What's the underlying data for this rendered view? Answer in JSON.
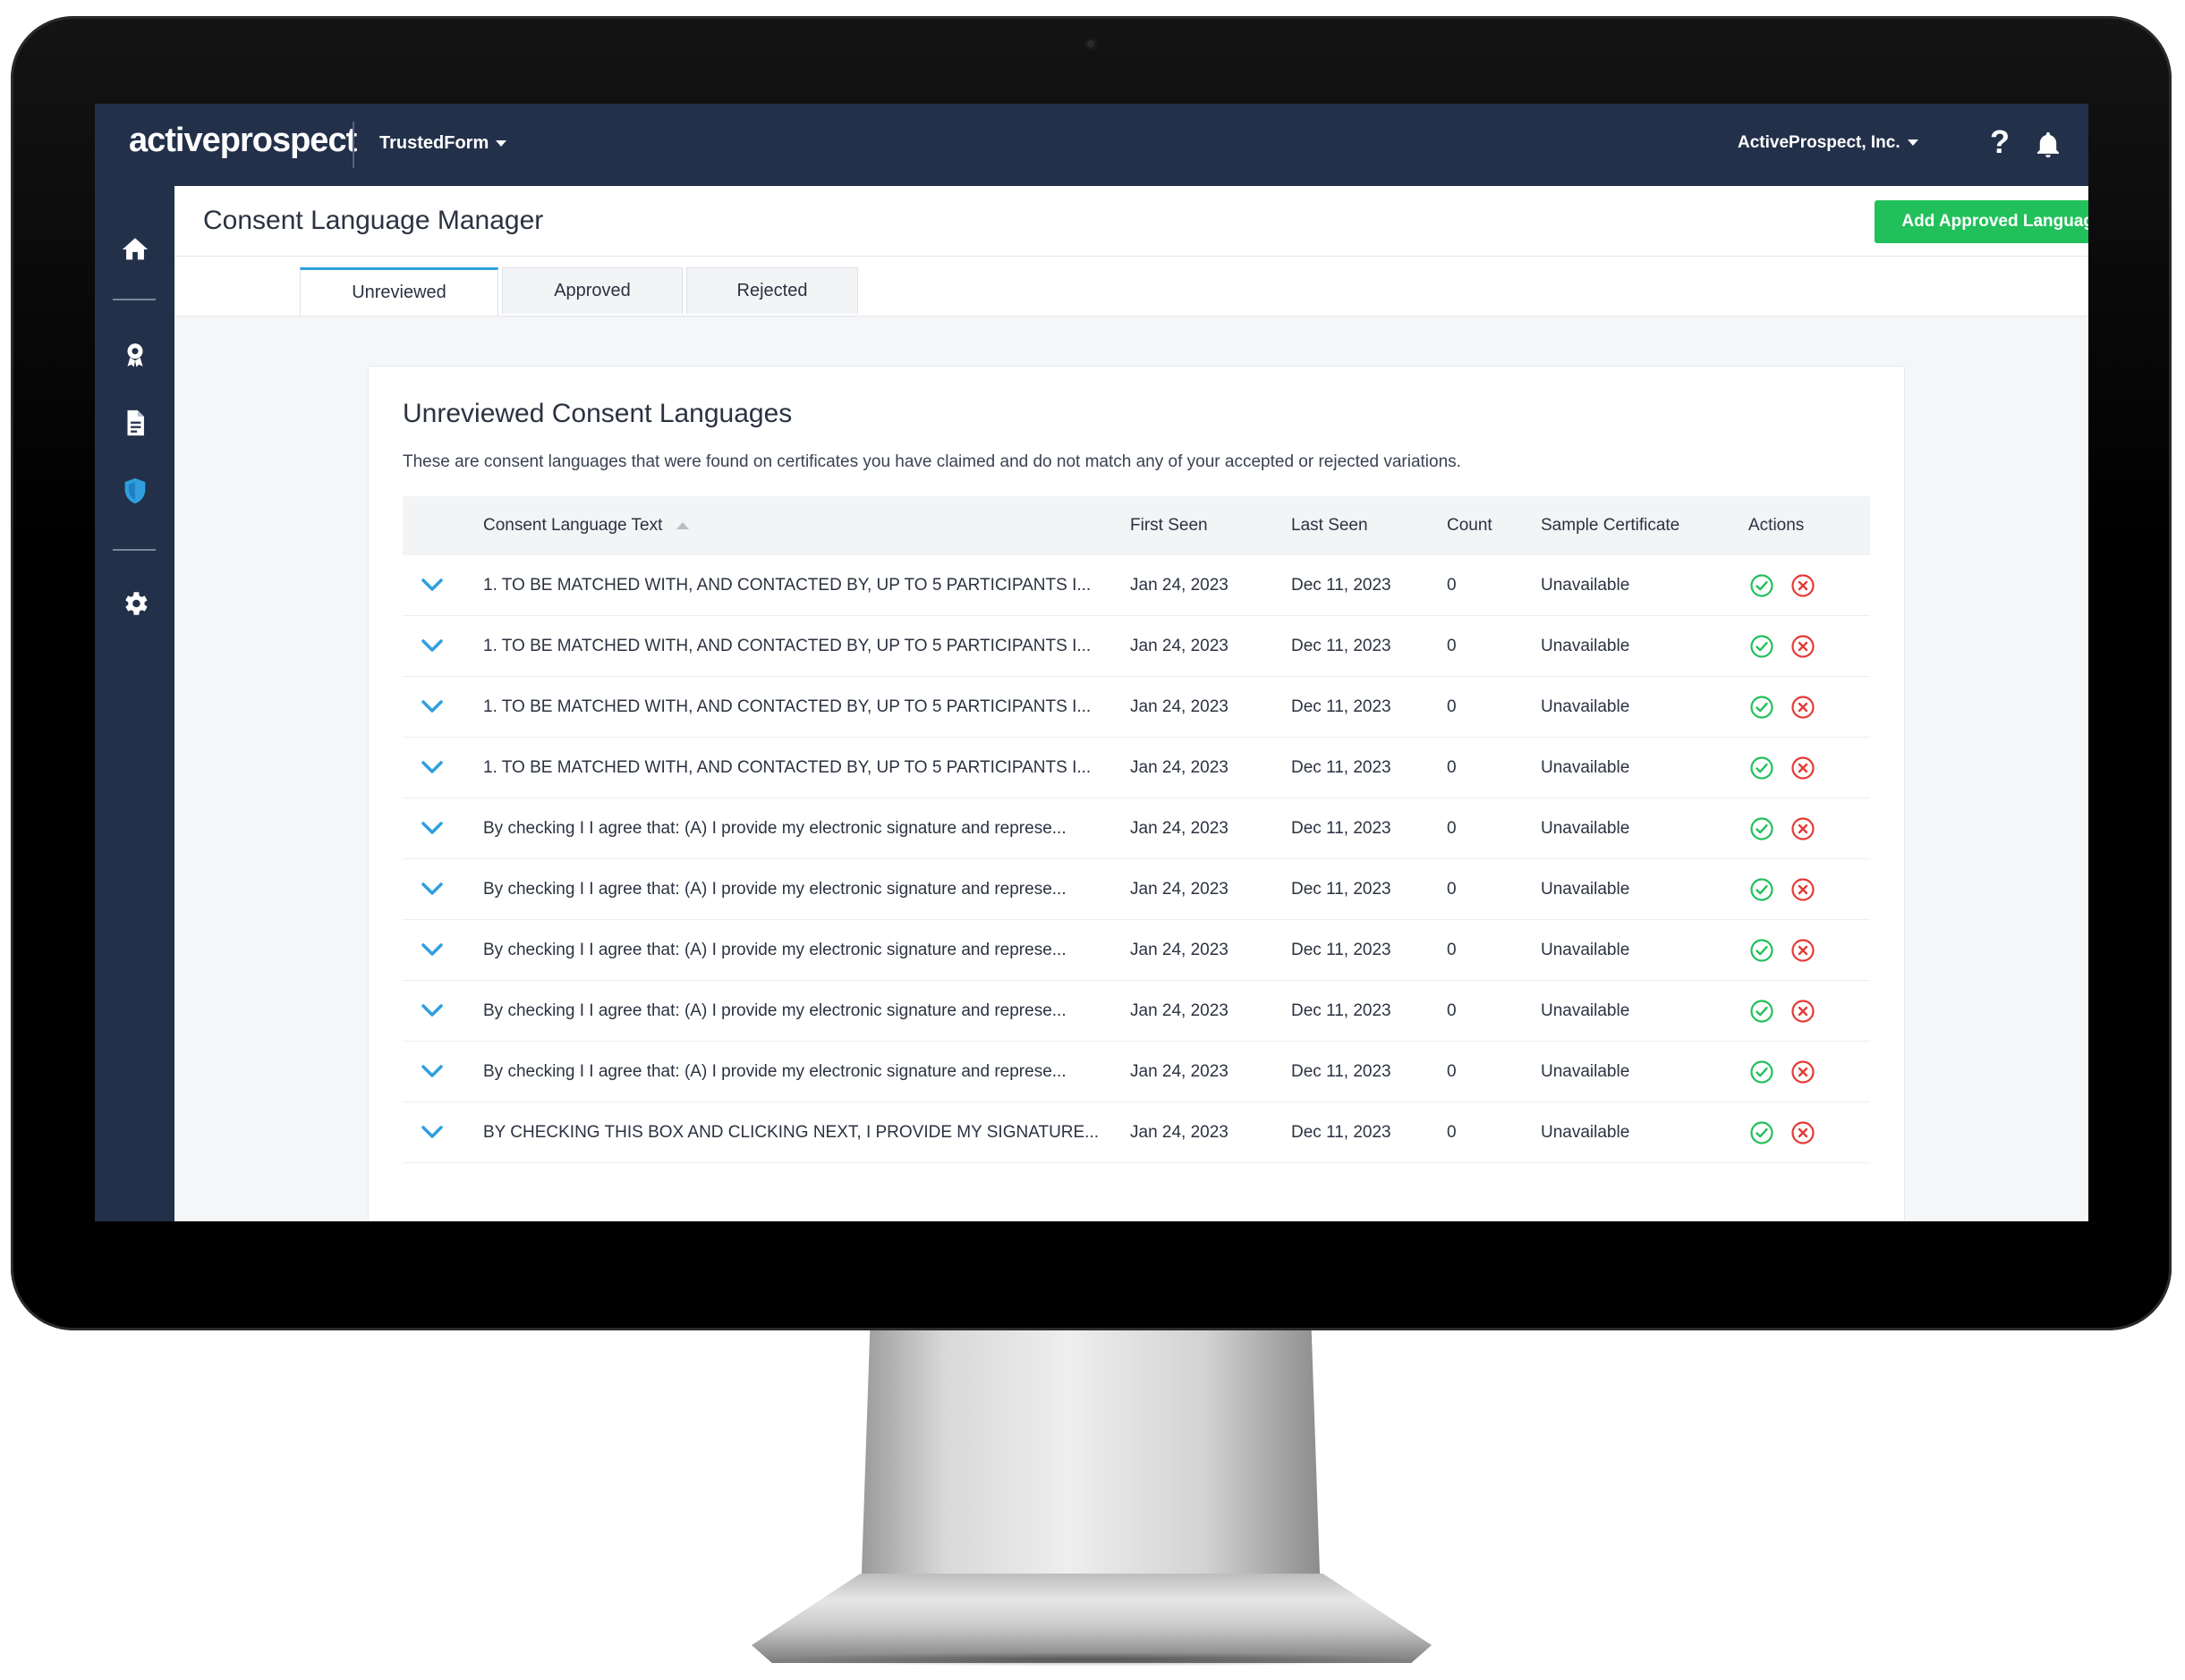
{
  "brand": {
    "logo_text": "activeprospect",
    "product": "TrustedForm"
  },
  "topbar": {
    "account": "ActiveProspect, Inc.",
    "help_label": "?"
  },
  "page": {
    "title": "Consent Language Manager",
    "add_button": "Add Approved Language"
  },
  "tabs": [
    {
      "label": "Unreviewed",
      "active": true
    },
    {
      "label": "Approved",
      "active": false
    },
    {
      "label": "Rejected",
      "active": false
    }
  ],
  "card": {
    "title": "Unreviewed Consent Languages",
    "description": "These are consent languages that were found on certificates you have claimed and do not match any of your accepted or rejected variations."
  },
  "table": {
    "columns": [
      "Consent Language Text",
      "First Seen",
      "Last Seen",
      "Count",
      "Sample Certificate",
      "Actions"
    ],
    "rows": [
      {
        "text": "1. TO BE MATCHED WITH, AND CONTACTED BY, UP TO 5 PARTICIPANTS I...",
        "first_seen": "Jan 24, 2023",
        "last_seen": "Dec 11, 2023",
        "count": "0",
        "sample": "Unavailable"
      },
      {
        "text": "1. TO BE MATCHED WITH, AND CONTACTED BY, UP TO 5 PARTICIPANTS I...",
        "first_seen": "Jan 24, 2023",
        "last_seen": "Dec 11, 2023",
        "count": "0",
        "sample": "Unavailable"
      },
      {
        "text": "1. TO BE MATCHED WITH, AND CONTACTED BY, UP TO 5 PARTICIPANTS I...",
        "first_seen": "Jan 24, 2023",
        "last_seen": "Dec 11, 2023",
        "count": "0",
        "sample": "Unavailable"
      },
      {
        "text": "1. TO BE MATCHED WITH, AND CONTACTED BY, UP TO 5 PARTICIPANTS I...",
        "first_seen": "Jan 24, 2023",
        "last_seen": "Dec 11, 2023",
        "count": "0",
        "sample": "Unavailable"
      },
      {
        "text": "By checking I I agree that: (A) I provide my electronic signature and represe...",
        "first_seen": "Jan 24, 2023",
        "last_seen": "Dec 11, 2023",
        "count": "0",
        "sample": "Unavailable"
      },
      {
        "text": "By checking I I agree that: (A) I provide my electronic signature and represe...",
        "first_seen": "Jan 24, 2023",
        "last_seen": "Dec 11, 2023",
        "count": "0",
        "sample": "Unavailable"
      },
      {
        "text": "By checking I I agree that: (A) I provide my electronic signature and represe...",
        "first_seen": "Jan 24, 2023",
        "last_seen": "Dec 11, 2023",
        "count": "0",
        "sample": "Unavailable"
      },
      {
        "text": "By checking I I agree that: (A) I provide my electronic signature and represe...",
        "first_seen": "Jan 24, 2023",
        "last_seen": "Dec 11, 2023",
        "count": "0",
        "sample": "Unavailable"
      },
      {
        "text": "By checking I I agree that: (A) I provide my electronic signature and represe...",
        "first_seen": "Jan 24, 2023",
        "last_seen": "Dec 11, 2023",
        "count": "0",
        "sample": "Unavailable"
      },
      {
        "text": "BY CHECKING THIS BOX AND CLICKING NEXT, I PROVIDE MY SIGNATURE...",
        "first_seen": "Jan 24, 2023",
        "last_seen": "Dec 11, 2023",
        "count": "0",
        "sample": "Unavailable"
      }
    ]
  },
  "colors": {
    "nav_bg": "#23304a",
    "accent_blue": "#2f9fe0",
    "approve_green": "#21c05a",
    "reject_red": "#e53935"
  },
  "icons": {
    "sidebar": [
      "home-icon",
      "badge-icon",
      "document-icon",
      "shield-icon",
      "gear-icon"
    ],
    "row_actions": [
      "approve-check-icon",
      "reject-x-icon"
    ],
    "expand": "chevron-down-icon"
  }
}
